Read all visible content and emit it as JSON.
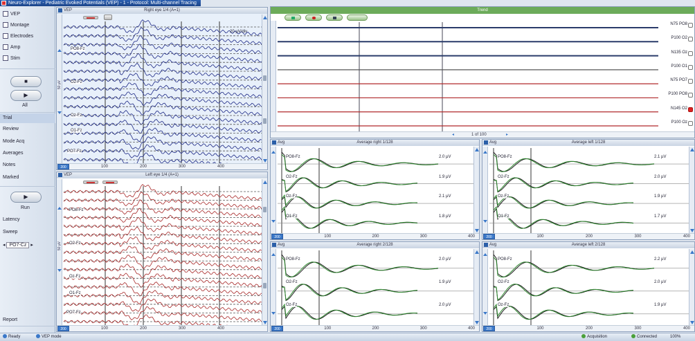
{
  "app": {
    "title": "Neuro-Explorer - Pediatric Evoked Potentials (VEP) - 1 - Protocol: Multi-channel Tracing"
  },
  "sidebar": {
    "items_top": [
      {
        "label": "VEP",
        "icon": "waveform-icon"
      },
      {
        "label": "Montage",
        "icon": "montage-icon"
      },
      {
        "label": "Electrodes",
        "icon": "electrode-icon"
      },
      {
        "label": "Amp",
        "icon": "amplifier-icon"
      },
      {
        "label": "Stim",
        "icon": "stimulus-icon"
      }
    ],
    "stop_label": "■",
    "play_label": "▶",
    "average_label": "All",
    "menu_items": [
      "Trial",
      "Review",
      "Mode Acq",
      "Averages",
      "Notes",
      "Marked"
    ],
    "run_label": "Run",
    "lower_items": [
      "Latency",
      "Sweep"
    ],
    "channel_select": "PO7-Cz",
    "bottom_label": "Report"
  },
  "raw_top": {
    "title": "Right eye 1/4 (A=1)",
    "tab": "VEP",
    "channels": [
      "PO8-Fz",
      "O2-Fz",
      "Oz-Fz",
      "O1-Fz",
      "PO7-Fz"
    ],
    "scale": "20 µV/div",
    "y_label": "50 µV",
    "range": "200",
    "x_ticks": [
      "0",
      "100",
      "200",
      "300",
      "400"
    ]
  },
  "raw_bottom": {
    "title": "Left eye 1/4 (A=1)",
    "tab": "VEP",
    "channels": [
      "PO8-Fz",
      "O2-Fz",
      "Oz-Fz",
      "O1-Fz",
      "PO7-Fz"
    ],
    "y_label": "50 µV",
    "range": "200",
    "x_ticks": [
      "0",
      "100",
      "200",
      "300",
      "400"
    ]
  },
  "trend": {
    "title": "Trend",
    "rows": [
      "N75 PO8",
      "P100 O2",
      "N135 Oz",
      "P100 O1",
      "N75 PO7",
      "P100 PO8",
      "N145 O2",
      "P100 Oz"
    ],
    "checked_row": 6,
    "footer": "1 of 100",
    "colors": {
      "dark": "#2a3b6a",
      "red": "#b0282a",
      "grid": "#7d8c9e"
    }
  },
  "averages": [
    {
      "title": "Average right 1/128",
      "tab": "Avg",
      "channels": [
        "PO8-Fz",
        "O2-Fz",
        "Oz-Fz",
        "O1-Fz"
      ],
      "units": [
        "2.0 µV",
        "1.9 µV",
        "2.1 µV",
        "1.8 µV"
      ],
      "range": "200",
      "x_ticks": [
        "0",
        "100",
        "200",
        "300",
        "400"
      ]
    },
    {
      "title": "Average left 1/128",
      "tab": "Avg",
      "channels": [
        "PO8-Fz",
        "O2-Fz",
        "Oz-Fz",
        "O1-Fz"
      ],
      "units": [
        "2.1 µV",
        "2.0 µV",
        "1.9 µV",
        "1.7 µV"
      ],
      "range": "200",
      "x_ticks": [
        "0",
        "100",
        "200",
        "300",
        "400"
      ]
    },
    {
      "title": "Average right 2/128",
      "tab": "Avg",
      "channels": [
        "PO8-Fz",
        "O2-Fz",
        "Oz-Fz"
      ],
      "units": [
        "2.0 µV",
        "1.9 µV",
        "2.0 µV"
      ],
      "range": "200",
      "x_ticks": [
        "0",
        "100",
        "200",
        "300",
        "400"
      ]
    },
    {
      "title": "Average left 2/128",
      "tab": "Avg",
      "channels": [
        "PO8-Fz",
        "O2-Fz",
        "Oz-Fz"
      ],
      "units": [
        "2.2 µV",
        "2.0 µV",
        "1.9 µV"
      ],
      "range": "200",
      "x_ticks": [
        "0",
        "100",
        "200",
        "300",
        "400"
      ]
    }
  ],
  "status": {
    "left": [
      "Ready",
      "VEP mode"
    ],
    "right": [
      "Acquisition",
      "Connected",
      "100%"
    ]
  }
}
